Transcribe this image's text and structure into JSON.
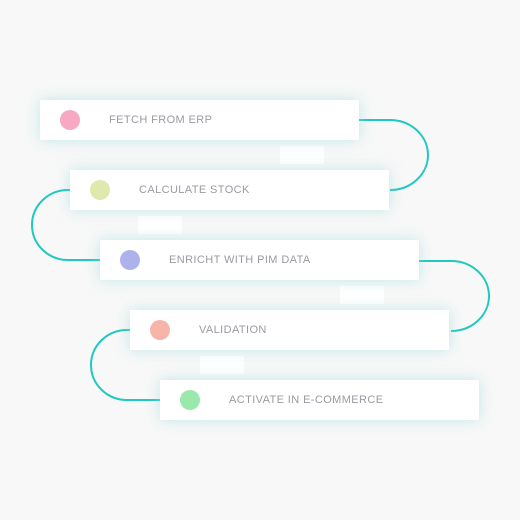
{
  "connector_color": "#1fc8c0",
  "steps": [
    {
      "label": "FETCH FROM ERP",
      "dot_color": "#f7a8c2"
    },
    {
      "label": "CALCULATE STOCK",
      "dot_color": "#dfe9ad"
    },
    {
      "label": "ENRICHT WITH PIM DATA",
      "dot_color": "#aeb2ec"
    },
    {
      "label": "VALIDATION",
      "dot_color": "#f7b4a8"
    },
    {
      "label": "ACTIVATE IN E-COMMERCE",
      "dot_color": "#9ae8ab"
    }
  ]
}
